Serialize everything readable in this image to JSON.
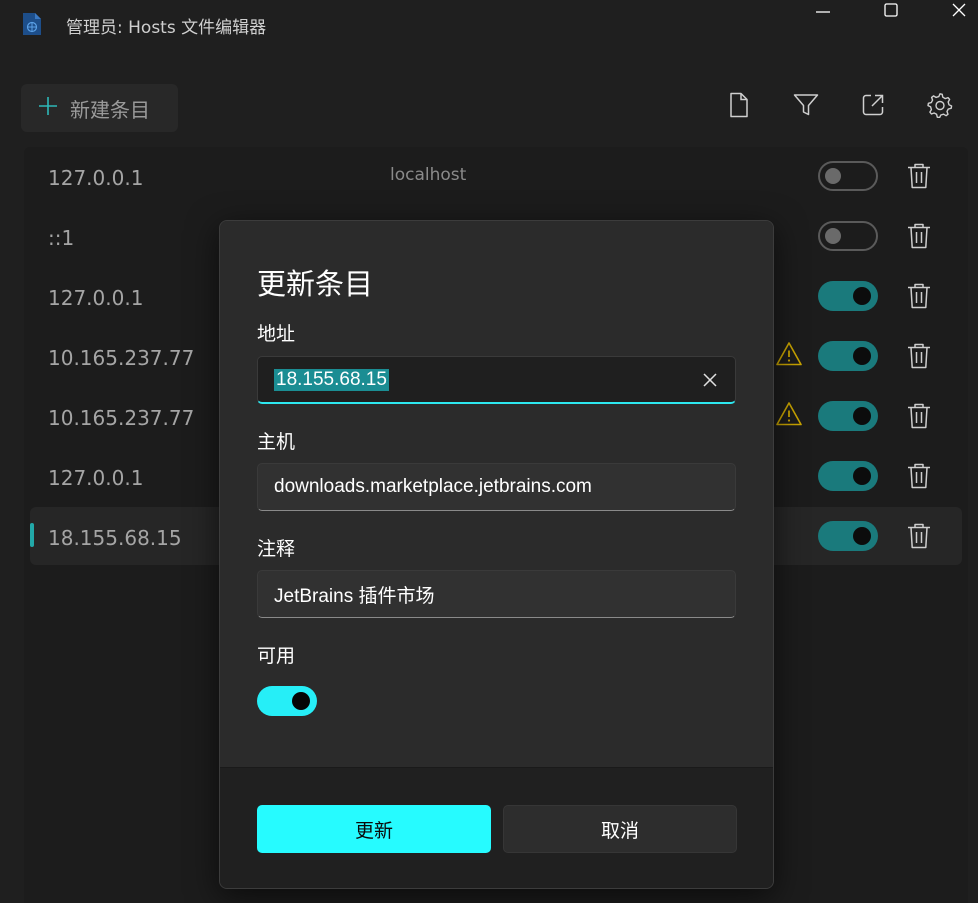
{
  "window": {
    "title": "管理员: Hosts 文件编辑器",
    "minimize_icon": "minimize-icon",
    "maximize_icon": "maximize-icon",
    "close_icon": "close-icon"
  },
  "toolbar": {
    "new_entry_label": "新建条目",
    "icons": [
      "file-icon",
      "filter-icon",
      "open-external-icon",
      "gear-icon"
    ]
  },
  "entries": [
    {
      "address": "127.0.0.1",
      "host": "localhost",
      "enabled": false,
      "warning": false,
      "selected": false
    },
    {
      "address": "::1",
      "host": "",
      "enabled": false,
      "warning": false,
      "selected": false
    },
    {
      "address": "127.0.0.1",
      "host": "",
      "enabled": true,
      "warning": false,
      "selected": false
    },
    {
      "address": "10.165.237.77",
      "host": "",
      "enabled": true,
      "warning": true,
      "selected": false
    },
    {
      "address": "10.165.237.77",
      "host": "",
      "enabled": true,
      "warning": true,
      "selected": false
    },
    {
      "address": "127.0.0.1",
      "host": "",
      "enabled": true,
      "warning": false,
      "selected": false
    },
    {
      "address": "18.155.68.15",
      "host": "",
      "enabled": true,
      "warning": false,
      "selected": true
    }
  ],
  "dialog": {
    "title": "更新条目",
    "address_label": "地址",
    "address_value": "18.155.68.15",
    "host_label": "主机",
    "host_value": "downloads.marketplace.jetbrains.com",
    "comment_label": "注释",
    "comment_value": "JetBrains 插件市场",
    "enabled_label": "可用",
    "enabled": true,
    "update_label": "更新",
    "cancel_label": "取消"
  },
  "colors": {
    "accent": "#26fbff",
    "toggle_on": "#1a7a7c",
    "warning": "#c9a400",
    "background": "#1f1f1f"
  }
}
